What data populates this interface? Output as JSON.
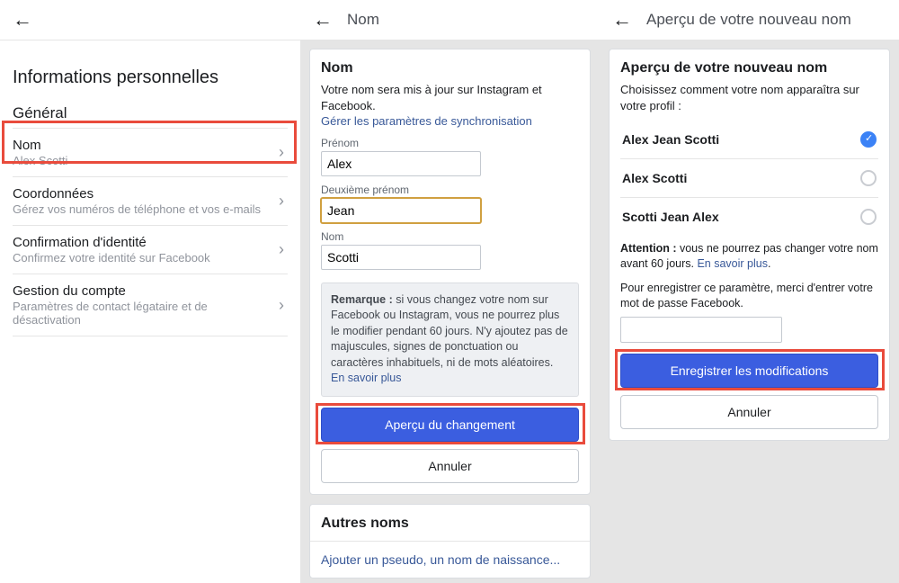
{
  "pane1": {
    "headerTitle": "Informations personnelles",
    "sectionLabel": "Général",
    "rows": [
      {
        "primary": "Nom",
        "secondary": "Alex Scotti"
      },
      {
        "primary": "Coordonnées",
        "secondary": "Gérez vos numéros de téléphone et vos e-mails"
      },
      {
        "primary": "Confirmation d'identité",
        "secondary": "Confirmez votre identité sur Facebook"
      },
      {
        "primary": "Gestion du compte",
        "secondary": "Paramètres de contact légataire et de désactivation"
      }
    ]
  },
  "pane2": {
    "topbarTitle": "Nom",
    "cardTitle": "Nom",
    "desc": "Votre nom sera mis à jour sur Instagram et Facebook.",
    "syncLink": "Gérer les paramètres de synchronisation",
    "labels": {
      "first": "Prénom",
      "middle": "Deuxième prénom",
      "last": "Nom"
    },
    "values": {
      "first": "Alex",
      "middle": "Jean",
      "last": "Scotti"
    },
    "noteBold": "Remarque :",
    "noteBody": " si vous changez votre nom sur Facebook ou Instagram, vous ne pourrez plus le modifier pendant 60 jours. N'y ajoutez pas de majuscules, signes de ponctuation ou caractères inhabituels, ni de mots aléatoires. ",
    "noteLink": "En savoir plus",
    "btnPreview": "Aperçu du changement",
    "btnCancel": "Annuler",
    "otherTitle": "Autres noms",
    "otherLink": "Ajouter un pseudo, un nom de naissance..."
  },
  "pane3": {
    "topbarTitle": "Aperçu de votre nouveau nom",
    "cardTitle": "Aperçu de votre nouveau nom",
    "desc": "Choisissez comment votre nom apparaîtra sur votre profil :",
    "options": [
      {
        "label": "Alex Jean Scotti",
        "checked": true
      },
      {
        "label": "Alex Scotti",
        "checked": false
      },
      {
        "label": "Scotti Jean Alex",
        "checked": false
      }
    ],
    "warnBold": "Attention :",
    "warnBody": " vous ne pourrez pas changer votre nom avant 60 jours. ",
    "warnLink": "En savoir plus",
    "pwPrompt": "Pour enregistrer ce paramètre, merci d'entrer votre mot de passe Facebook.",
    "btnSave": "Enregistrer les modifications",
    "btnCancel": "Annuler"
  }
}
